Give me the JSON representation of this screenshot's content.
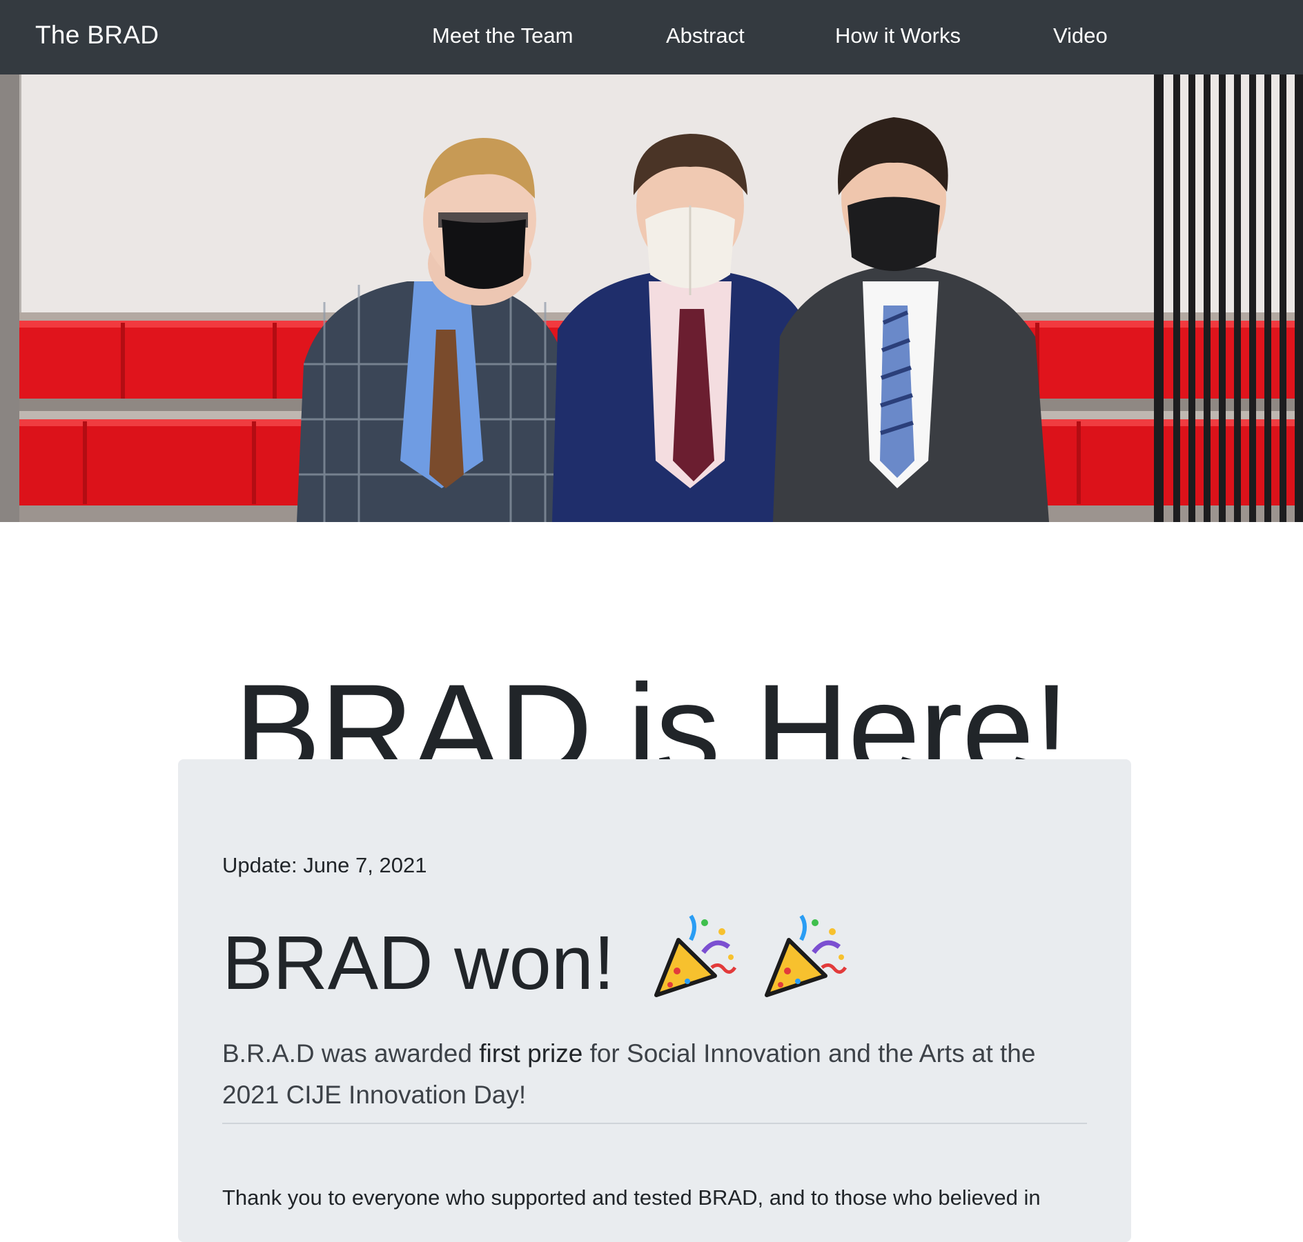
{
  "navbar": {
    "brand": "The BRAD",
    "links": [
      "Meet the Team",
      "Abstract",
      "How it Works",
      "Video"
    ],
    "background": "#343a40"
  },
  "hero": {
    "alt": "Three team members in suits and masks standing in front of red bleachers"
  },
  "main": {
    "title": "BRAD is Here!"
  },
  "update": {
    "date_line": "Update: June 7, 2021",
    "headline": "BRAD won!",
    "icons": [
      "party-popper-icon",
      "party-popper-icon"
    ],
    "lead_before": "B.R.A.D was awarded ",
    "lead_bold": "first prize",
    "lead_after": " for Social Innovation and the Arts at the 2021 CIJE Innovation Day!",
    "thanks": "Thank you to everyone who supported and tested BRAD, and to those who believed in"
  },
  "colors": {
    "card_background": "#e9ecef",
    "text": "#212529",
    "bleacher_red": "#e0141c"
  }
}
